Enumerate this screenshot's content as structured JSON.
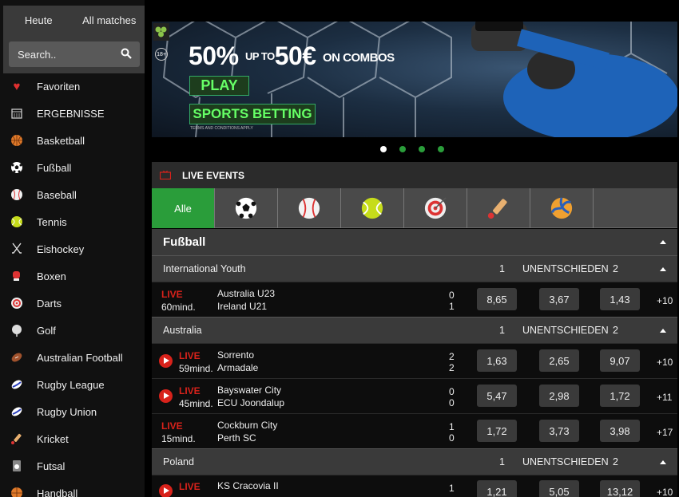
{
  "sidebar": {
    "tabs": [
      {
        "label": "Heute"
      },
      {
        "label": "All matches"
      }
    ],
    "search_placeholder": "Search..",
    "items": [
      {
        "label": "Favoriten",
        "icon": "heart-icon"
      },
      {
        "label": "ERGEBNISSE",
        "icon": "calendar-icon"
      },
      {
        "label": "Basketball",
        "icon": "basketball-icon"
      },
      {
        "label": "Fußball",
        "icon": "soccer-ball-icon"
      },
      {
        "label": "Baseball",
        "icon": "baseball-icon"
      },
      {
        "label": "Tennis",
        "icon": "tennis-ball-icon"
      },
      {
        "label": "Eishockey",
        "icon": "hockey-sticks-icon"
      },
      {
        "label": "Boxen",
        "icon": "boxing-glove-icon"
      },
      {
        "label": "Darts",
        "icon": "dartboard-icon"
      },
      {
        "label": "Golf",
        "icon": "golf-ball-icon"
      },
      {
        "label": "Australian Football",
        "icon": "australian-football-icon"
      },
      {
        "label": "Rugby League",
        "icon": "rugby-ball-icon"
      },
      {
        "label": "Rugby Union",
        "icon": "rugby-ball-icon"
      },
      {
        "label": "Kricket",
        "icon": "cricket-bat-icon"
      },
      {
        "label": "Futsal",
        "icon": "futsal-icon"
      },
      {
        "label": "Handball",
        "icon": "handball-icon"
      }
    ]
  },
  "banner": {
    "age_badge": "18+",
    "headline_big1": "50%",
    "headline_small1": "UP TO",
    "headline_big2": "50€",
    "headline_small2": "ON COMBOS",
    "play_label": "PLAY",
    "sports_label": "SPORTS BETTING",
    "terms": "TERMS AND CONDITIONS APPLY"
  },
  "live_events": {
    "title": "LIVE EVENTS",
    "tabs": [
      {
        "label": "Alle",
        "icon": ""
      },
      {
        "label": "",
        "icon": "soccer-ball-icon"
      },
      {
        "label": "",
        "icon": "baseball-icon"
      },
      {
        "label": "",
        "icon": "tennis-ball-icon"
      },
      {
        "label": "",
        "icon": "dartboard-icon"
      },
      {
        "label": "",
        "icon": "cricket-bat-icon"
      },
      {
        "label": "",
        "icon": "volleyball-icon"
      }
    ]
  },
  "section": {
    "title": "Fußball"
  },
  "col_labels": {
    "one": "1",
    "draw": "UNENTSCHIEDEN",
    "two": "2"
  },
  "leagues": [
    {
      "name": "International Youth",
      "matches": [
        {
          "live": "LIVE",
          "minutes": "60mind.",
          "home": "Australia U23",
          "away": "Ireland U21",
          "score_home": "0",
          "score_away": "1",
          "odd1": "8,65",
          "oddx": "3,67",
          "odd2": "1,43",
          "more": "+10",
          "stream": false
        }
      ]
    },
    {
      "name": "Australia",
      "matches": [
        {
          "live": "LIVE",
          "minutes": "59mind.",
          "home": "Sorrento",
          "away": "Armadale",
          "score_home": "2",
          "score_away": "2",
          "odd1": "1,63",
          "oddx": "2,65",
          "odd2": "9,07",
          "more": "+10",
          "stream": true
        },
        {
          "live": "LIVE",
          "minutes": "45mind.",
          "home": "Bayswater City",
          "away": "ECU Joondalup",
          "score_home": "0",
          "score_away": "0",
          "odd1": "5,47",
          "oddx": "2,98",
          "odd2": "1,72",
          "more": "+11",
          "stream": true
        },
        {
          "live": "LIVE",
          "minutes": "15mind.",
          "home": "Cockburn City",
          "away": "Perth SC",
          "score_home": "1",
          "score_away": "0",
          "odd1": "1,72",
          "oddx": "3,73",
          "odd2": "3,98",
          "more": "+17",
          "stream": false
        }
      ]
    },
    {
      "name": "Poland",
      "matches": [
        {
          "live": "LIVE",
          "minutes": "",
          "home": "KS Cracovia II",
          "away": "",
          "score_home": "1",
          "score_away": "",
          "odd1": "1,21",
          "oddx": "5,05",
          "odd2": "13,12",
          "more": "+10",
          "stream": true
        }
      ]
    }
  ]
}
